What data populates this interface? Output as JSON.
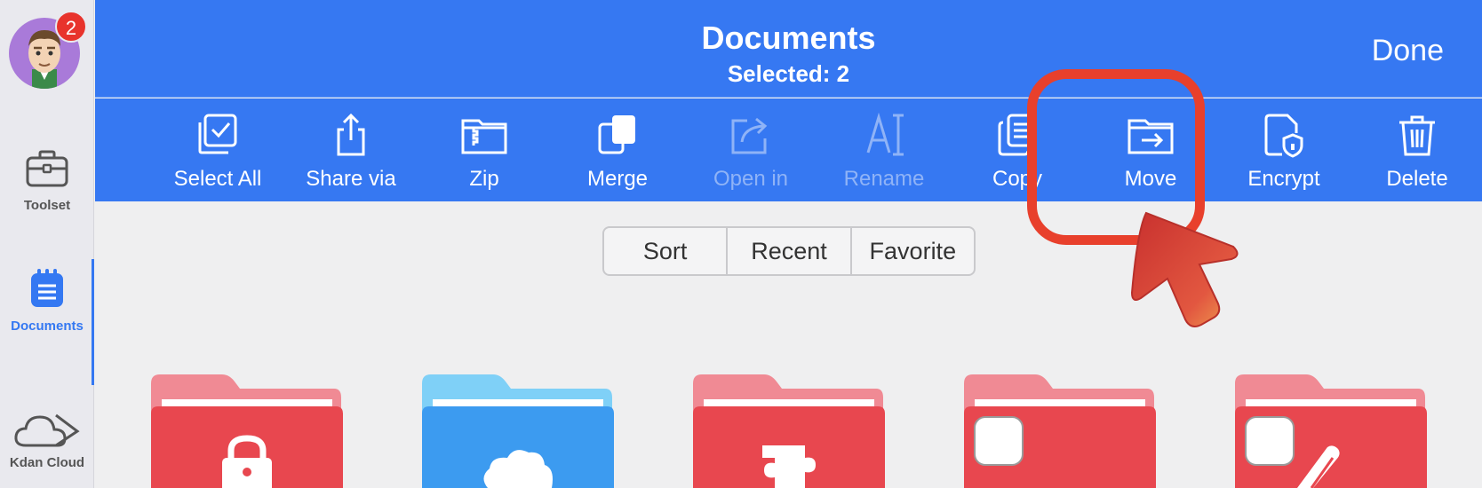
{
  "sidebar": {
    "badge_count": "2",
    "items": [
      {
        "label": "Toolset",
        "icon": "briefcase-icon"
      },
      {
        "label": "Documents",
        "icon": "document-list-icon",
        "active": true
      },
      {
        "label": "Kdan Cloud",
        "icon": "cloud-icon"
      }
    ]
  },
  "header": {
    "title": "Documents",
    "subtitle": "Selected: 2",
    "done_label": "Done"
  },
  "toolbar": {
    "items": [
      {
        "label": "Select All",
        "icon": "select-all-icon",
        "enabled": true
      },
      {
        "label": "Share via",
        "icon": "share-icon",
        "enabled": true
      },
      {
        "label": "Zip",
        "icon": "zip-icon",
        "enabled": true
      },
      {
        "label": "Merge",
        "icon": "merge-icon",
        "enabled": true
      },
      {
        "label": "Open in",
        "icon": "open-in-icon",
        "enabled": false
      },
      {
        "label": "Rename",
        "icon": "rename-icon",
        "enabled": false
      },
      {
        "label": "Copy",
        "icon": "copy-icon",
        "enabled": true
      },
      {
        "label": "Move",
        "icon": "move-folder-icon",
        "enabled": true
      },
      {
        "label": "Encrypt",
        "icon": "encrypt-icon",
        "enabled": true
      },
      {
        "label": "Delete",
        "icon": "trash-icon",
        "enabled": true
      }
    ]
  },
  "segment": {
    "options": [
      "Sort",
      "Recent",
      "Favorite"
    ]
  },
  "folders": [
    {
      "color": "#e8474f",
      "icon": "lock-icon"
    },
    {
      "color": "#3c9bf0",
      "icon": "cloud-icon"
    },
    {
      "color": "#e8474f",
      "icon": "puzzle-icon"
    },
    {
      "color": "#e8474f",
      "icon": "checkbox-icon"
    },
    {
      "color": "#e8474f",
      "icon": "checkbox-icon"
    }
  ],
  "colors": {
    "accent": "#3678f2",
    "highlight": "#e8402c"
  }
}
